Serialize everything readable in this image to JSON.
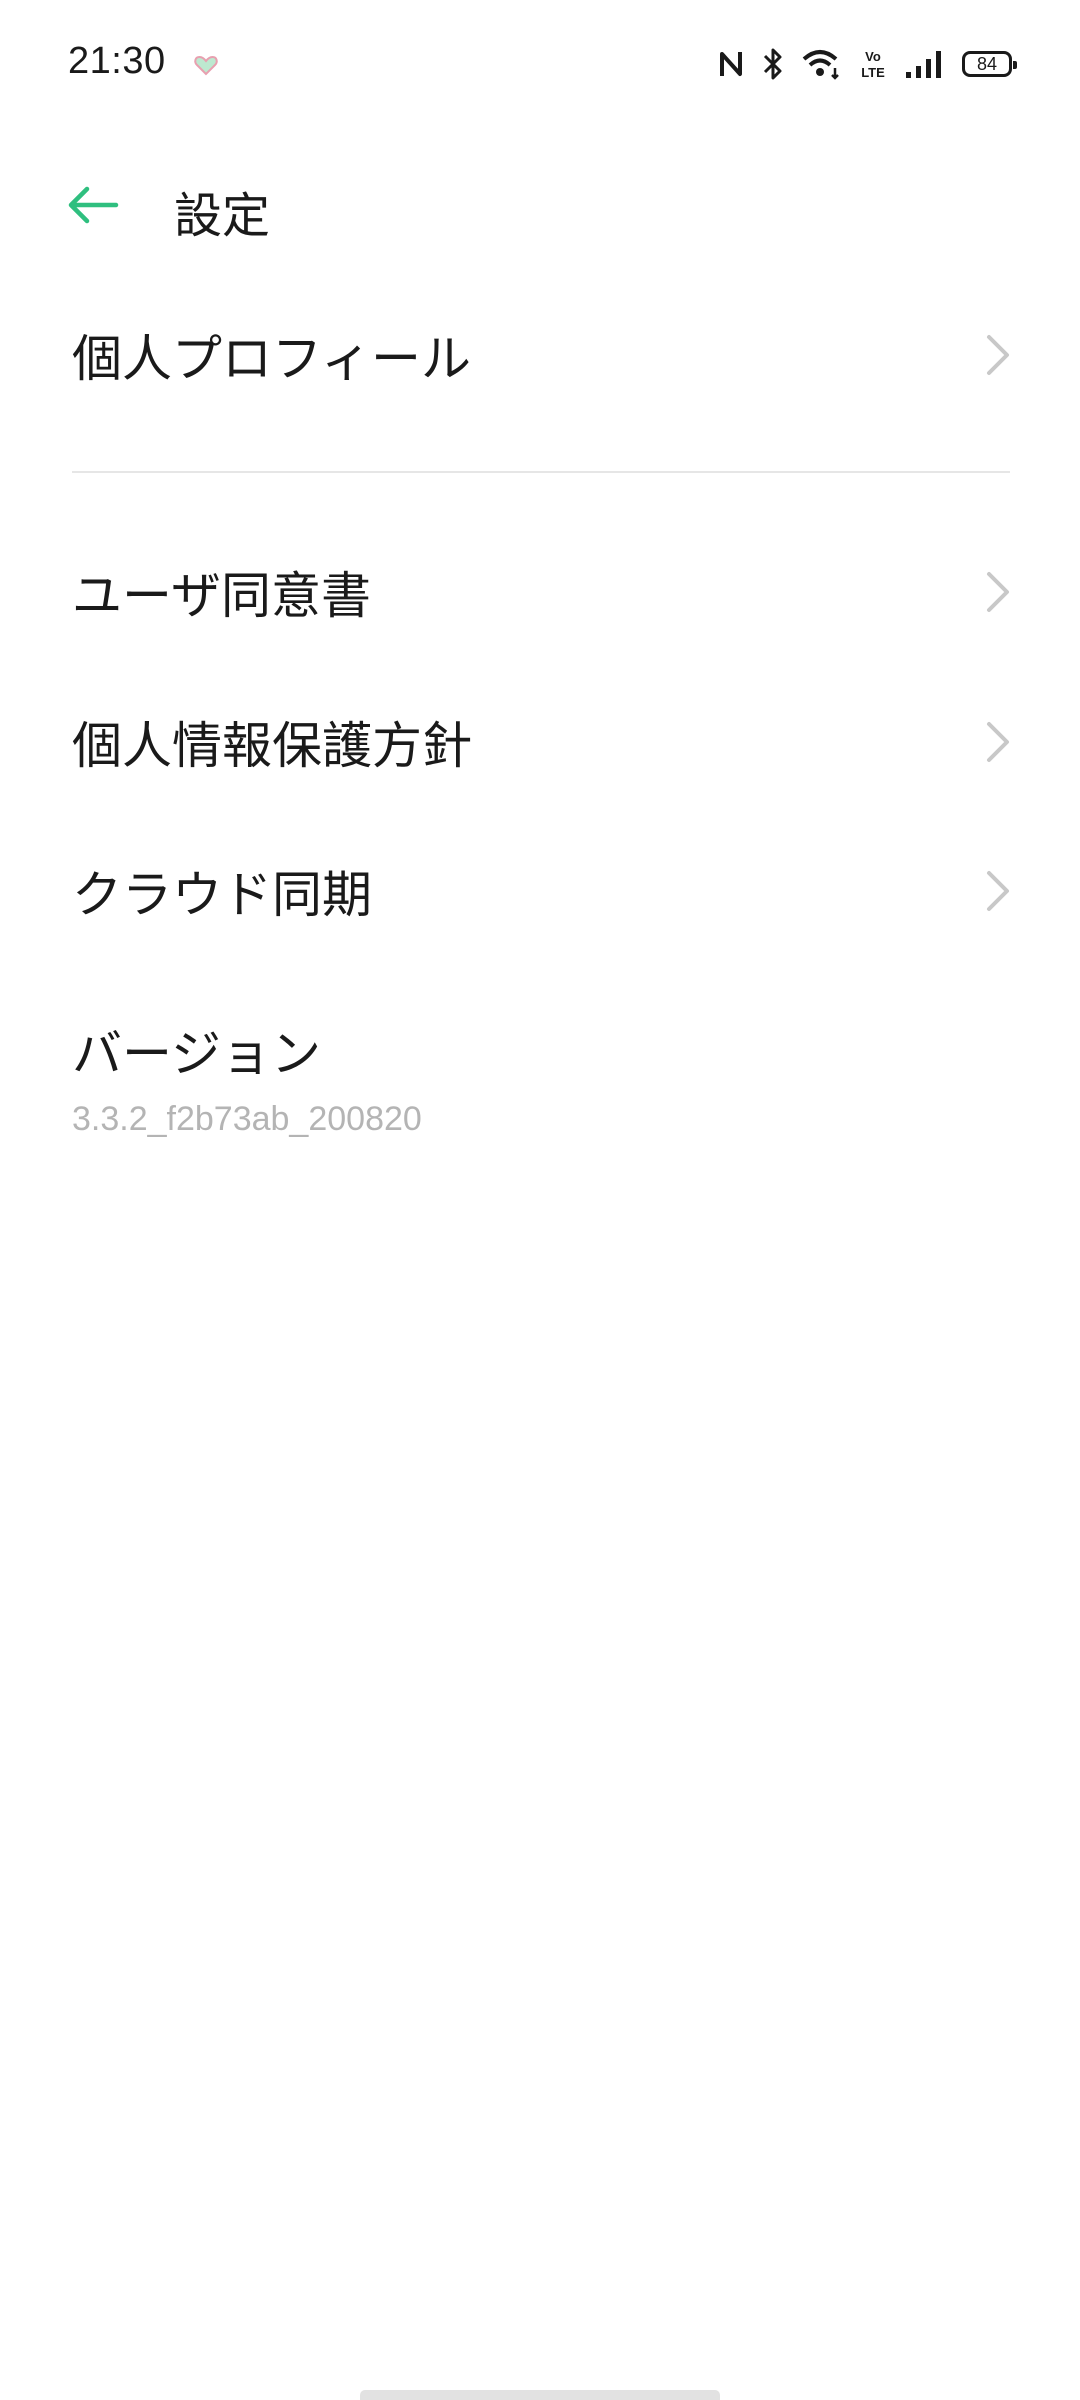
{
  "status_bar": {
    "time": "21:30",
    "battery": "84",
    "icons": [
      "heart-icon",
      "nfc-icon",
      "bluetooth-icon",
      "wifi-icon",
      "volte-icon",
      "signal-icon",
      "battery-icon"
    ]
  },
  "header": {
    "title": "設定",
    "back_icon": "arrow-left-icon",
    "accent_color": "#2fbf7f"
  },
  "settings": {
    "items": [
      {
        "label": "個人プロフィール"
      },
      {
        "label": "ユーザ同意書"
      },
      {
        "label": "個人情報保護方針"
      },
      {
        "label": "クラウド同期"
      }
    ],
    "version": {
      "label": "バージョン",
      "value": "3.3.2_f2b73ab_200820"
    }
  }
}
